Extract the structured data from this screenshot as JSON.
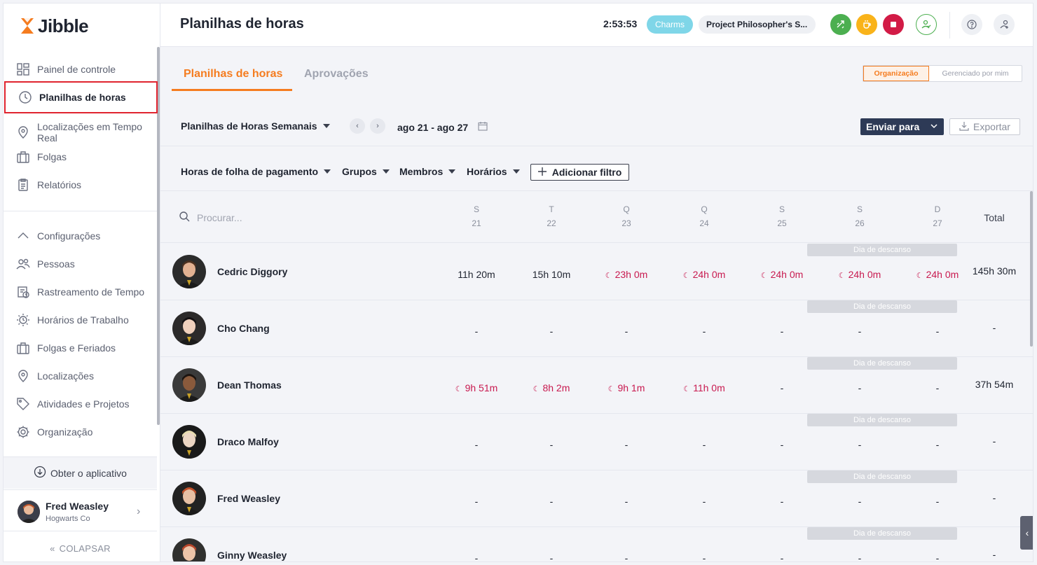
{
  "brand": {
    "name": "Jibble",
    "accent": "#f57c1f"
  },
  "sidebar": {
    "items_top": [
      {
        "label": "Painel de controle",
        "icon": "dashboard-icon"
      },
      {
        "label": "Planilhas de horas",
        "icon": "clock-icon",
        "active": true
      },
      {
        "label": "Localizações em Tempo Real",
        "icon": "location-pin-icon"
      },
      {
        "label": "Folgas",
        "icon": "suitcase-icon"
      },
      {
        "label": "Relatórios",
        "icon": "clipboard-icon"
      }
    ],
    "items_settings": [
      {
        "label": "Configurações",
        "icon": "chevron-up-icon"
      },
      {
        "label": "Pessoas",
        "icon": "people-icon"
      },
      {
        "label": "Rastreamento de Tempo",
        "icon": "tracking-icon"
      },
      {
        "label": "Horários de Trabalho",
        "icon": "sun-clock-icon"
      },
      {
        "label": "Folgas e Feriados",
        "icon": "suitcase-icon"
      },
      {
        "label": "Localizações",
        "icon": "location-pin-icon"
      },
      {
        "label": "Atividades e Projetos",
        "icon": "tag-icon"
      },
      {
        "label": "Organização",
        "icon": "gear-icon"
      }
    ],
    "get_app": "Obter o aplicativo",
    "user": {
      "name": "Fred Weasley",
      "org": "Hogwarts Co"
    },
    "collapse": "COLAPSAR"
  },
  "header": {
    "title": "Planilhas de horas",
    "timer": "2:53:53",
    "activity": "Charms",
    "project": "Project Philosopher's S..."
  },
  "tabs": [
    {
      "label": "Planilhas de horas",
      "active": true
    },
    {
      "label": "Aprovações",
      "active": false
    }
  ],
  "scope": {
    "options": [
      "Organização",
      "Gerenciado por mim"
    ],
    "selected": "Organização"
  },
  "toolbar": {
    "view": "Planilhas de Horas Semanais",
    "date_range": "ago 21 - ago 27",
    "send": "Enviar para",
    "export": "Exportar"
  },
  "filters": {
    "items": [
      "Horas de folha de pagamento",
      "Grupos",
      "Membros",
      "Horários"
    ],
    "add": "Adicionar filtro"
  },
  "table": {
    "search_placeholder": "Procurar...",
    "days": [
      {
        "letter": "S",
        "num": "21"
      },
      {
        "letter": "T",
        "num": "22"
      },
      {
        "letter": "Q",
        "num": "23"
      },
      {
        "letter": "Q",
        "num": "24"
      },
      {
        "letter": "S",
        "num": "25"
      },
      {
        "letter": "S",
        "num": "26"
      },
      {
        "letter": "D",
        "num": "27"
      }
    ],
    "total_label": "Total",
    "rest_label": "Dia de descanso",
    "rows": [
      {
        "name": "Cedric Diggory",
        "cells": [
          {
            "v": "11h 20m",
            "over": false
          },
          {
            "v": "15h 10m",
            "over": false
          },
          {
            "v": "23h 0m",
            "over": true
          },
          {
            "v": "24h 0m",
            "over": true
          },
          {
            "v": "24h 0m",
            "over": true
          },
          {
            "v": "24h 0m",
            "over": true
          },
          {
            "v": "24h 0m",
            "over": true
          }
        ],
        "total": "145h 30m"
      },
      {
        "name": "Cho Chang",
        "cells": [
          {
            "v": "-"
          },
          {
            "v": "-"
          },
          {
            "v": "-"
          },
          {
            "v": "-"
          },
          {
            "v": "-"
          },
          {
            "v": "-"
          },
          {
            "v": "-"
          }
        ],
        "total": "-"
      },
      {
        "name": "Dean Thomas",
        "cells": [
          {
            "v": "9h 51m",
            "over": true
          },
          {
            "v": "8h 2m",
            "over": true
          },
          {
            "v": "9h 1m",
            "over": true
          },
          {
            "v": "11h 0m",
            "over": true
          },
          {
            "v": "-"
          },
          {
            "v": "-"
          },
          {
            "v": "-"
          }
        ],
        "total": "37h 54m"
      },
      {
        "name": "Draco Malfoy",
        "cells": [
          {
            "v": "-"
          },
          {
            "v": "-"
          },
          {
            "v": "-"
          },
          {
            "v": "-"
          },
          {
            "v": "-"
          },
          {
            "v": "-"
          },
          {
            "v": "-"
          }
        ],
        "total": "-"
      },
      {
        "name": "Fred Weasley",
        "cells": [
          {
            "v": "-"
          },
          {
            "v": "-"
          },
          {
            "v": "-"
          },
          {
            "v": "-"
          },
          {
            "v": "-"
          },
          {
            "v": "-"
          },
          {
            "v": "-"
          }
        ],
        "total": "-"
      },
      {
        "name": "Ginny Weasley",
        "cells": [
          {
            "v": "-"
          },
          {
            "v": "-"
          },
          {
            "v": "-"
          },
          {
            "v": "-"
          },
          {
            "v": "-"
          },
          {
            "v": "-"
          },
          {
            "v": "-"
          }
        ],
        "total": "-"
      }
    ]
  }
}
